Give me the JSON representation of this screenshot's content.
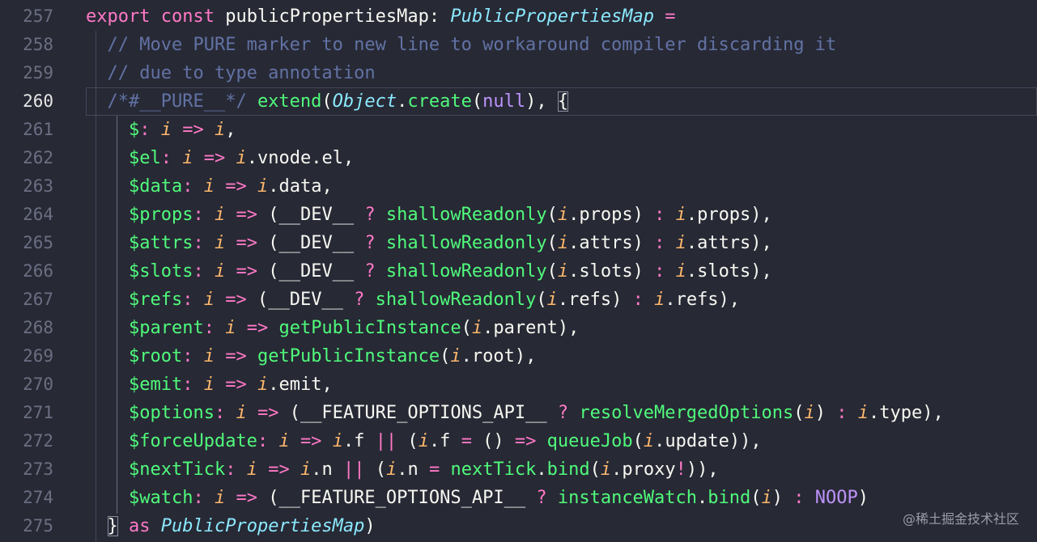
{
  "editor": {
    "lines": [
      {
        "no": "257",
        "active": false,
        "tokens": [
          [
            "k",
            "export"
          ],
          [
            "pl",
            " "
          ],
          [
            "k",
            "const"
          ],
          [
            "pl",
            " publicPropertiesMap: "
          ],
          [
            "t",
            "PublicPropertiesMap"
          ],
          [
            "pl",
            " "
          ],
          [
            "k",
            "="
          ]
        ]
      },
      {
        "no": "258",
        "active": false,
        "tokens": [
          [
            "pl",
            "  "
          ],
          [
            "c",
            "// Move PURE marker to new line to workaround compiler discarding it"
          ]
        ]
      },
      {
        "no": "259",
        "active": false,
        "tokens": [
          [
            "pl",
            "  "
          ],
          [
            "c",
            "// due to type annotation"
          ]
        ]
      },
      {
        "no": "260",
        "active": true,
        "tokens": [
          [
            "pl",
            "  "
          ],
          [
            "c",
            "/*#__PURE__*/"
          ],
          [
            "pl",
            " "
          ],
          [
            "f",
            "extend"
          ],
          [
            "pl",
            "("
          ],
          [
            "t",
            "Object"
          ],
          [
            "pl",
            "."
          ],
          [
            "f",
            "create"
          ],
          [
            "pl",
            "("
          ],
          [
            "g",
            "null"
          ],
          [
            "pl",
            "), "
          ],
          [
            "pl bracket-match",
            "{"
          ]
        ]
      },
      {
        "no": "261",
        "active": false,
        "tokens": [
          [
            "pl",
            "    "
          ],
          [
            "f",
            "$"
          ],
          [
            "k",
            ":"
          ],
          [
            "pl",
            " "
          ],
          [
            "p",
            "i"
          ],
          [
            "pl",
            " "
          ],
          [
            "k",
            "=>"
          ],
          [
            "pl",
            " "
          ],
          [
            "p",
            "i"
          ],
          [
            "pl",
            ","
          ]
        ]
      },
      {
        "no": "262",
        "active": false,
        "tokens": [
          [
            "pl",
            "    "
          ],
          [
            "f",
            "$el"
          ],
          [
            "k",
            ":"
          ],
          [
            "pl",
            " "
          ],
          [
            "p",
            "i"
          ],
          [
            "pl",
            " "
          ],
          [
            "k",
            "=>"
          ],
          [
            "pl",
            " "
          ],
          [
            "p",
            "i"
          ],
          [
            "pl",
            ".vnode.el,"
          ]
        ]
      },
      {
        "no": "263",
        "active": false,
        "tokens": [
          [
            "pl",
            "    "
          ],
          [
            "f",
            "$data"
          ],
          [
            "k",
            ":"
          ],
          [
            "pl",
            " "
          ],
          [
            "p",
            "i"
          ],
          [
            "pl",
            " "
          ],
          [
            "k",
            "=>"
          ],
          [
            "pl",
            " "
          ],
          [
            "p",
            "i"
          ],
          [
            "pl",
            ".data,"
          ]
        ]
      },
      {
        "no": "264",
        "active": false,
        "tokens": [
          [
            "pl",
            "    "
          ],
          [
            "f",
            "$props"
          ],
          [
            "k",
            ":"
          ],
          [
            "pl",
            " "
          ],
          [
            "p",
            "i"
          ],
          [
            "pl",
            " "
          ],
          [
            "k",
            "=>"
          ],
          [
            "pl",
            " (__DEV__ "
          ],
          [
            "k",
            "?"
          ],
          [
            "pl",
            " "
          ],
          [
            "f",
            "shallowReadonly"
          ],
          [
            "pl",
            "("
          ],
          [
            "p",
            "i"
          ],
          [
            "pl",
            ".props) "
          ],
          [
            "k",
            ":"
          ],
          [
            "pl",
            " "
          ],
          [
            "p",
            "i"
          ],
          [
            "pl",
            ".props),"
          ]
        ]
      },
      {
        "no": "265",
        "active": false,
        "tokens": [
          [
            "pl",
            "    "
          ],
          [
            "f",
            "$attrs"
          ],
          [
            "k",
            ":"
          ],
          [
            "pl",
            " "
          ],
          [
            "p",
            "i"
          ],
          [
            "pl",
            " "
          ],
          [
            "k",
            "=>"
          ],
          [
            "pl",
            " (__DEV__ "
          ],
          [
            "k",
            "?"
          ],
          [
            "pl",
            " "
          ],
          [
            "f",
            "shallowReadonly"
          ],
          [
            "pl",
            "("
          ],
          [
            "p",
            "i"
          ],
          [
            "pl",
            ".attrs) "
          ],
          [
            "k",
            ":"
          ],
          [
            "pl",
            " "
          ],
          [
            "p",
            "i"
          ],
          [
            "pl",
            ".attrs),"
          ]
        ]
      },
      {
        "no": "266",
        "active": false,
        "tokens": [
          [
            "pl",
            "    "
          ],
          [
            "f",
            "$slots"
          ],
          [
            "k",
            ":"
          ],
          [
            "pl",
            " "
          ],
          [
            "p",
            "i"
          ],
          [
            "pl",
            " "
          ],
          [
            "k",
            "=>"
          ],
          [
            "pl",
            " (__DEV__ "
          ],
          [
            "k",
            "?"
          ],
          [
            "pl",
            " "
          ],
          [
            "f",
            "shallowReadonly"
          ],
          [
            "pl",
            "("
          ],
          [
            "p",
            "i"
          ],
          [
            "pl",
            ".slots) "
          ],
          [
            "k",
            ":"
          ],
          [
            "pl",
            " "
          ],
          [
            "p",
            "i"
          ],
          [
            "pl",
            ".slots),"
          ]
        ]
      },
      {
        "no": "267",
        "active": false,
        "tokens": [
          [
            "pl",
            "    "
          ],
          [
            "f",
            "$refs"
          ],
          [
            "k",
            ":"
          ],
          [
            "pl",
            " "
          ],
          [
            "p",
            "i"
          ],
          [
            "pl",
            " "
          ],
          [
            "k",
            "=>"
          ],
          [
            "pl",
            " (__DEV__ "
          ],
          [
            "k",
            "?"
          ],
          [
            "pl",
            " "
          ],
          [
            "f",
            "shallowReadonly"
          ],
          [
            "pl",
            "("
          ],
          [
            "p",
            "i"
          ],
          [
            "pl",
            ".refs) "
          ],
          [
            "k",
            ":"
          ],
          [
            "pl",
            " "
          ],
          [
            "p",
            "i"
          ],
          [
            "pl",
            ".refs),"
          ]
        ]
      },
      {
        "no": "268",
        "active": false,
        "tokens": [
          [
            "pl",
            "    "
          ],
          [
            "f",
            "$parent"
          ],
          [
            "k",
            ":"
          ],
          [
            "pl",
            " "
          ],
          [
            "p",
            "i"
          ],
          [
            "pl",
            " "
          ],
          [
            "k",
            "=>"
          ],
          [
            "pl",
            " "
          ],
          [
            "f",
            "getPublicInstance"
          ],
          [
            "pl",
            "("
          ],
          [
            "p",
            "i"
          ],
          [
            "pl",
            ".parent),"
          ]
        ]
      },
      {
        "no": "269",
        "active": false,
        "tokens": [
          [
            "pl",
            "    "
          ],
          [
            "f",
            "$root"
          ],
          [
            "k",
            ":"
          ],
          [
            "pl",
            " "
          ],
          [
            "p",
            "i"
          ],
          [
            "pl",
            " "
          ],
          [
            "k",
            "=>"
          ],
          [
            "pl",
            " "
          ],
          [
            "f",
            "getPublicInstance"
          ],
          [
            "pl",
            "("
          ],
          [
            "p",
            "i"
          ],
          [
            "pl",
            ".root),"
          ]
        ]
      },
      {
        "no": "270",
        "active": false,
        "tokens": [
          [
            "pl",
            "    "
          ],
          [
            "f",
            "$emit"
          ],
          [
            "k",
            ":"
          ],
          [
            "pl",
            " "
          ],
          [
            "p",
            "i"
          ],
          [
            "pl",
            " "
          ],
          [
            "k",
            "=>"
          ],
          [
            "pl",
            " "
          ],
          [
            "p",
            "i"
          ],
          [
            "pl",
            ".emit,"
          ]
        ]
      },
      {
        "no": "271",
        "active": false,
        "tokens": [
          [
            "pl",
            "    "
          ],
          [
            "f",
            "$options"
          ],
          [
            "k",
            ":"
          ],
          [
            "pl",
            " "
          ],
          [
            "p",
            "i"
          ],
          [
            "pl",
            " "
          ],
          [
            "k",
            "=>"
          ],
          [
            "pl",
            " (__FEATURE_OPTIONS_API__ "
          ],
          [
            "k",
            "?"
          ],
          [
            "pl",
            " "
          ],
          [
            "f",
            "resolveMergedOptions"
          ],
          [
            "pl",
            "("
          ],
          [
            "p",
            "i"
          ],
          [
            "pl",
            ") "
          ],
          [
            "k",
            ":"
          ],
          [
            "pl",
            " "
          ],
          [
            "p",
            "i"
          ],
          [
            "pl",
            ".type),"
          ]
        ]
      },
      {
        "no": "272",
        "active": false,
        "tokens": [
          [
            "pl",
            "    "
          ],
          [
            "f",
            "$forceUpdate"
          ],
          [
            "k",
            ":"
          ],
          [
            "pl",
            " "
          ],
          [
            "p",
            "i"
          ],
          [
            "pl",
            " "
          ],
          [
            "k",
            "=>"
          ],
          [
            "pl",
            " "
          ],
          [
            "p",
            "i"
          ],
          [
            "pl",
            ".f "
          ],
          [
            "k",
            "||"
          ],
          [
            "pl",
            " ("
          ],
          [
            "p",
            "i"
          ],
          [
            "pl",
            ".f "
          ],
          [
            "k",
            "="
          ],
          [
            "pl",
            " () "
          ],
          [
            "k",
            "=>"
          ],
          [
            "pl",
            " "
          ],
          [
            "f",
            "queueJob"
          ],
          [
            "pl",
            "("
          ],
          [
            "p",
            "i"
          ],
          [
            "pl",
            ".update)),"
          ]
        ]
      },
      {
        "no": "273",
        "active": false,
        "tokens": [
          [
            "pl",
            "    "
          ],
          [
            "f",
            "$nextTick"
          ],
          [
            "k",
            ":"
          ],
          [
            "pl",
            " "
          ],
          [
            "p",
            "i"
          ],
          [
            "pl",
            " "
          ],
          [
            "k",
            "=>"
          ],
          [
            "pl",
            " "
          ],
          [
            "p",
            "i"
          ],
          [
            "pl",
            ".n "
          ],
          [
            "k",
            "||"
          ],
          [
            "pl",
            " ("
          ],
          [
            "p",
            "i"
          ],
          [
            "pl",
            ".n "
          ],
          [
            "k",
            "="
          ],
          [
            "pl",
            " "
          ],
          [
            "f",
            "nextTick"
          ],
          [
            "pl",
            "."
          ],
          [
            "f",
            "bind"
          ],
          [
            "pl",
            "("
          ],
          [
            "p",
            "i"
          ],
          [
            "pl",
            ".proxy"
          ],
          [
            "k",
            "!"
          ],
          [
            "pl",
            ")),"
          ]
        ]
      },
      {
        "no": "274",
        "active": false,
        "tokens": [
          [
            "pl",
            "    "
          ],
          [
            "f",
            "$watch"
          ],
          [
            "k",
            ":"
          ],
          [
            "pl",
            " "
          ],
          [
            "p",
            "i"
          ],
          [
            "pl",
            " "
          ],
          [
            "k",
            "=>"
          ],
          [
            "pl",
            " (__FEATURE_OPTIONS_API__ "
          ],
          [
            "k",
            "?"
          ],
          [
            "pl",
            " "
          ],
          [
            "f",
            "instanceWatch"
          ],
          [
            "pl",
            "."
          ],
          [
            "f",
            "bind"
          ],
          [
            "pl",
            "("
          ],
          [
            "p",
            "i"
          ],
          [
            "pl",
            ") "
          ],
          [
            "k",
            ":"
          ],
          [
            "pl",
            " "
          ],
          [
            "g",
            "NOOP"
          ],
          [
            "pl",
            ")"
          ]
        ]
      },
      {
        "no": "275",
        "active": false,
        "tokens": [
          [
            "pl",
            "  "
          ],
          [
            "pl bracket-match",
            "}"
          ],
          [
            "pl",
            " "
          ],
          [
            "k",
            "as"
          ],
          [
            "pl",
            " "
          ],
          [
            "t",
            "PublicPropertiesMap"
          ],
          [
            "pl",
            ")"
          ]
        ]
      }
    ]
  },
  "watermark": "@稀土掘金技术社区"
}
